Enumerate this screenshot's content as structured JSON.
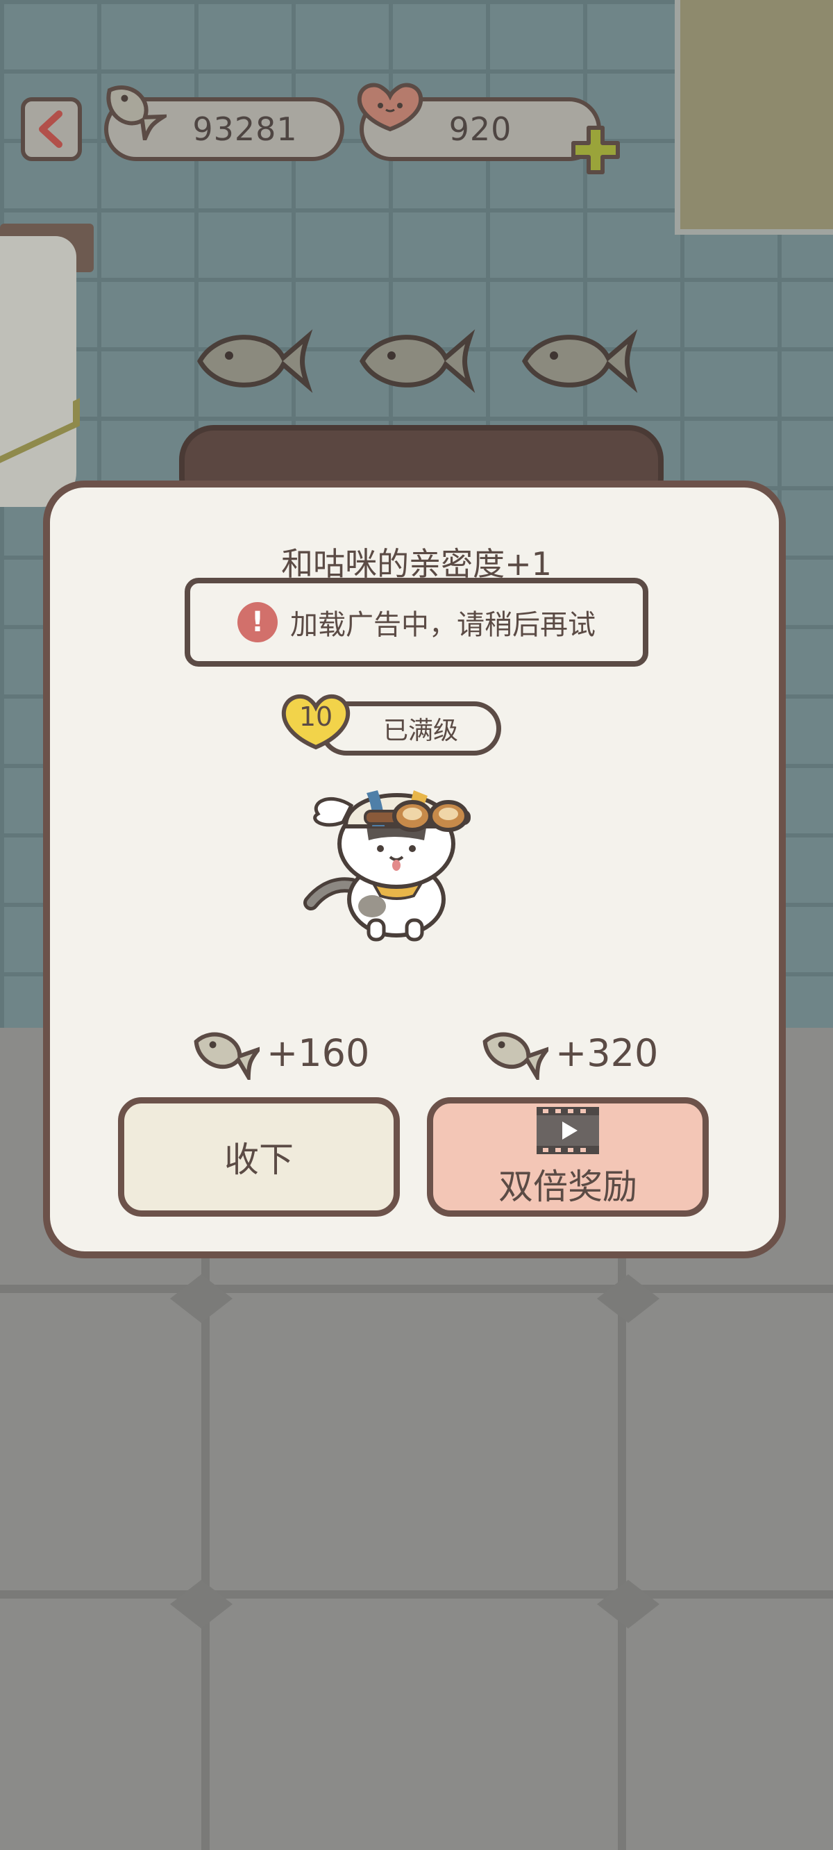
{
  "hud": {
    "fish_count": "93281",
    "heart_count": "920"
  },
  "dialog": {
    "affinity_text": "和咕咪的亲密度+1",
    "toast_text": "加载广告中，请稍后再试",
    "level_number": "10",
    "level_status": "已满级",
    "reward_normal": "+160",
    "reward_double": "+320",
    "collect_label": "收下",
    "double_label": "双倍奖励"
  },
  "colors": {
    "dialog_bg": "#f4f2ec",
    "border_brown": "#6c524a",
    "collect_btn": "#f0ebdc",
    "double_btn": "#f3c6b6",
    "warning_red": "#d2706b",
    "level_yellow": "#f2d34a",
    "plus_green": "#9aa43a"
  },
  "icons": [
    "back-arrow-icon",
    "fish-icon",
    "heart-icon",
    "plus-icon",
    "warning-icon",
    "video-icon",
    "cat-character"
  ]
}
